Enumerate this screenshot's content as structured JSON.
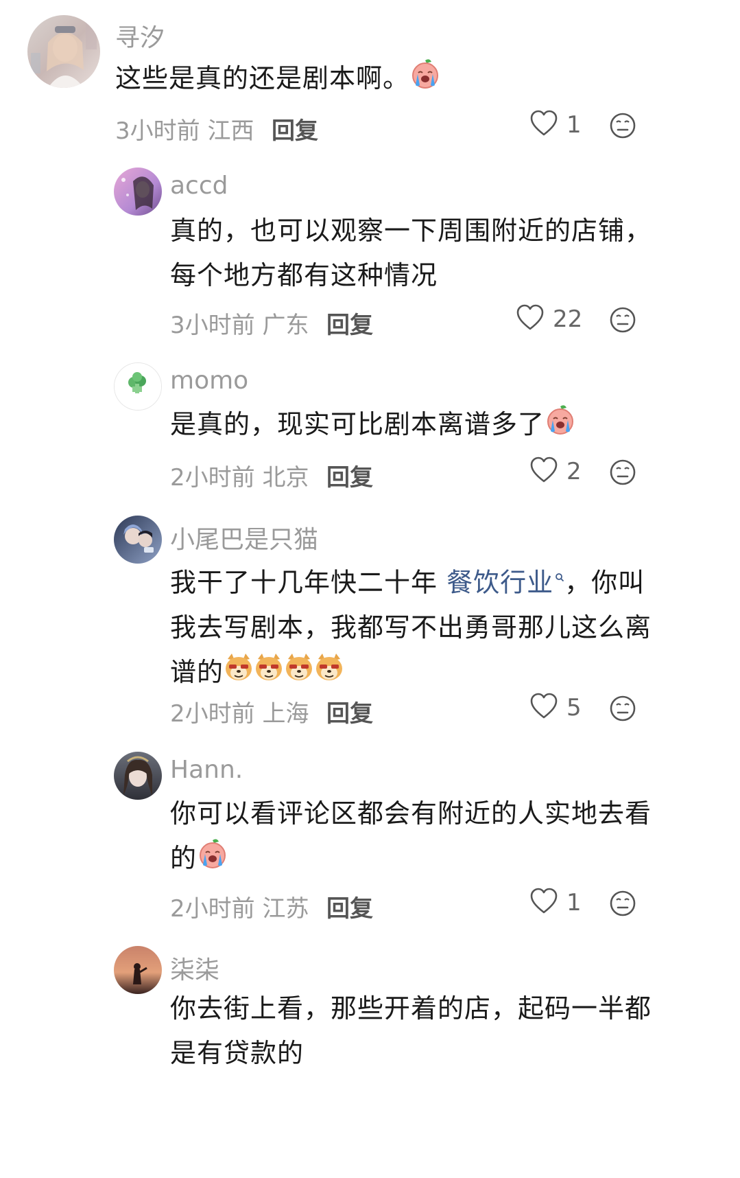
{
  "comments": [
    {
      "username": "寻汐",
      "text": "这些是真的还是剧本啊。",
      "time": "3小时前",
      "location": "江西",
      "reply_label": "回复",
      "likes": "1",
      "emojis": [
        "crying-peach-emoji"
      ]
    },
    {
      "username": "accd",
      "text_line1": "真的，也可以观察一下周围附近的店铺，",
      "text_line2": "每个地方都有这种情况",
      "time": "3小时前",
      "location": "广东",
      "reply_label": "回复",
      "likes": "22"
    },
    {
      "username": "momo",
      "text": "是真的，现实可比剧本离谱多了",
      "time": "2小时前",
      "location": "北京",
      "reply_label": "回复",
      "likes": "2",
      "emojis": [
        "crying-peach-emoji"
      ]
    },
    {
      "username": "小尾巴是只猫",
      "text_part1": "我干了十几年快二十年 ",
      "link_text": "餐饮行业",
      "text_part2": "，你叫",
      "text_line2": "我去写剧本，我都写不出勇哥那儿这么离",
      "text_line3": "谱的",
      "time": "2小时前",
      "location": "上海",
      "reply_label": "回复",
      "likes": "5",
      "emojis": [
        "shiba-smirk-emoji",
        "shiba-smirk-emoji",
        "shiba-smirk-emoji",
        "shiba-smirk-emoji"
      ]
    },
    {
      "username": "Hann.",
      "text_line1": "你可以看评论区都会有附近的人实地去看",
      "text_line2": "的",
      "time": "2小时前",
      "location": "江苏",
      "reply_label": "回复",
      "likes": "1",
      "emojis": [
        "crying-peach-emoji"
      ]
    },
    {
      "username": "柒柒",
      "text_line1": "你去街上看，那些开着的店，起码一半都",
      "text_line2": "是有贷款的"
    }
  ],
  "icons": {
    "like": "heart-outline-icon",
    "emoji_reaction": "neutral-face-icon",
    "link_search": "search-icon"
  },
  "colors": {
    "username": "#9a9a9a",
    "body_text": "#1a1a1a",
    "meta": "#9a9a9a",
    "reply": "#555555",
    "link": "#3d5a8a"
  }
}
